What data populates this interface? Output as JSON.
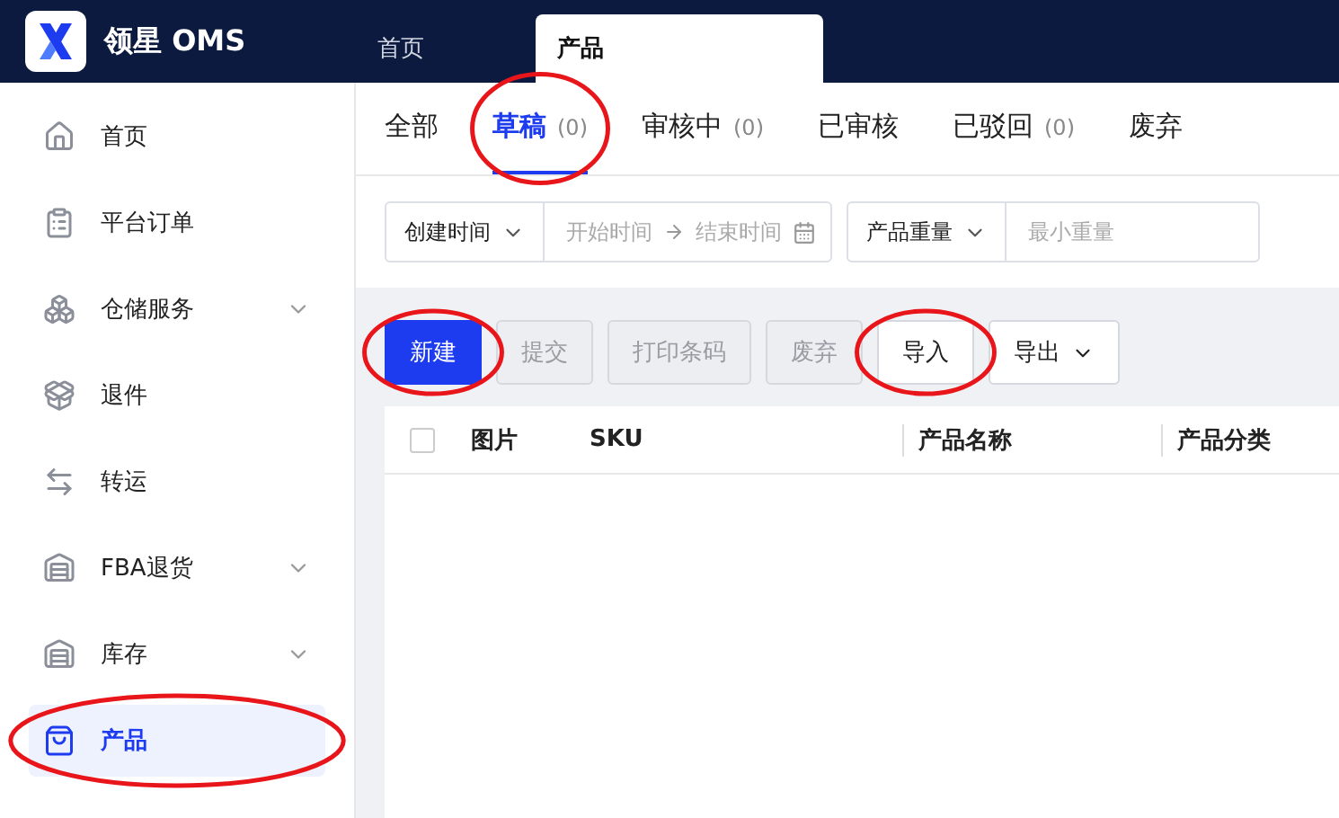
{
  "app": {
    "title": "领星 OMS"
  },
  "page_tabs": [
    {
      "label": "首页",
      "selected": false
    },
    {
      "label": "产品",
      "selected": true
    }
  ],
  "sidebar": {
    "items": [
      {
        "label": "首页",
        "kind": "home",
        "expandable": false,
        "selected": false,
        "circled": false
      },
      {
        "label": "平台订单",
        "kind": "clipboard",
        "expandable": false,
        "selected": false,
        "circled": false
      },
      {
        "label": "仓储服务",
        "kind": "storage",
        "expandable": true,
        "selected": false,
        "circled": false
      },
      {
        "label": "退件",
        "kind": "return",
        "expandable": false,
        "selected": false,
        "circled": false
      },
      {
        "label": "转运",
        "kind": "transfer",
        "expandable": false,
        "selected": false,
        "circled": false
      },
      {
        "label": "FBA退货",
        "kind": "fba",
        "expandable": true,
        "selected": false,
        "circled": false
      },
      {
        "label": "库存",
        "kind": "stock",
        "expandable": true,
        "selected": false,
        "circled": false
      },
      {
        "label": "产品",
        "kind": "bag",
        "expandable": false,
        "selected": true,
        "circled": true
      }
    ]
  },
  "status_tabs": [
    {
      "label": "全部",
      "selected": false,
      "circled": false
    },
    {
      "label": "草稿",
      "count": "(0)",
      "selected": true,
      "circled": true
    },
    {
      "label": "审核中",
      "count": "(0)",
      "selected": false,
      "circled": false
    },
    {
      "label": "已审核",
      "selected": false,
      "circled": false
    },
    {
      "label": "已驳回",
      "count": "(0)",
      "selected": false,
      "circled": false
    },
    {
      "label": "废弃",
      "selected": false,
      "circled": false
    }
  ],
  "filters": {
    "date_type": "创建时间",
    "start_placeholder": "开始时间",
    "end_placeholder": "结束时间",
    "weight_type": "产品重量",
    "min_weight_placeholder": "最小重量"
  },
  "actions": [
    {
      "label": "新建",
      "kind": "primary",
      "disabled": false,
      "dropdown": false,
      "circled": true
    },
    {
      "label": "提交",
      "kind": "default",
      "disabled": true,
      "dropdown": false,
      "circled": false
    },
    {
      "label": "打印条码",
      "kind": "default",
      "disabled": true,
      "dropdown": false,
      "circled": false
    },
    {
      "label": "废弃",
      "kind": "default",
      "disabled": true,
      "dropdown": false,
      "circled": false
    },
    {
      "label": "导入",
      "kind": "default",
      "disabled": false,
      "dropdown": false,
      "circled": true
    },
    {
      "label": "导出",
      "kind": "default",
      "disabled": false,
      "dropdown": true,
      "circled": false
    }
  ],
  "table": {
    "select_all_checked": false,
    "columns": [
      "图片",
      "SKU",
      "产品名称",
      "产品分类"
    ]
  }
}
